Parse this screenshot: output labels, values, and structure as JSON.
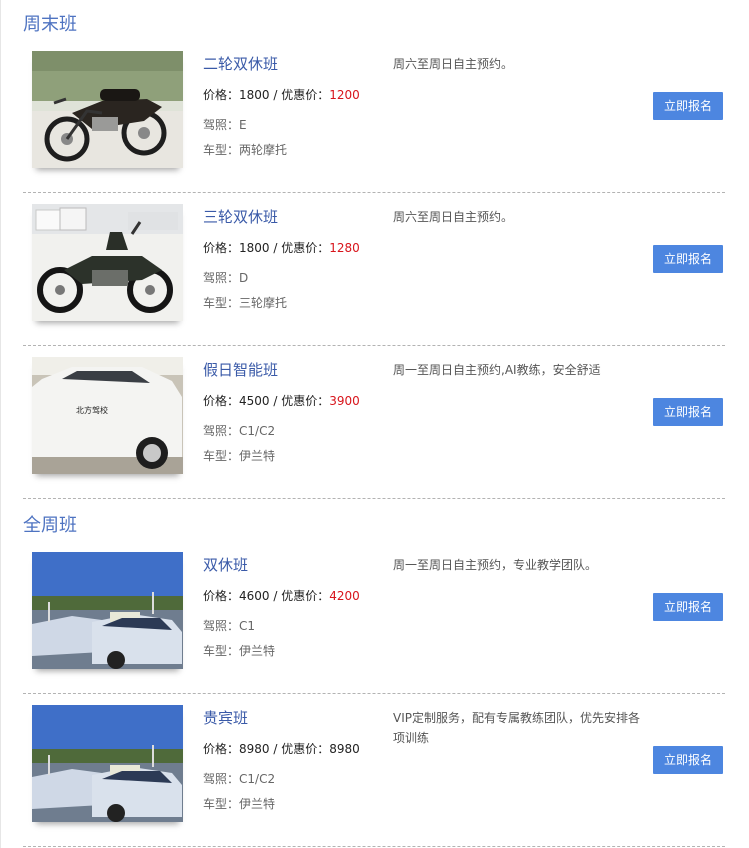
{
  "sections": [
    {
      "title": "周末班",
      "courses": [
        {
          "name": "二轮双休班",
          "price_label": "价格：",
          "price": "1800",
          "separator": " / 优惠价：",
          "discount_price": "1200",
          "license_label": "驾照：",
          "license": "E",
          "model_label": "车型：",
          "model": "两轮摩托",
          "description": "周六至周日自主预约。",
          "button": "立即报名",
          "image": "motorcycle-photo"
        },
        {
          "name": "三轮双休班",
          "price_label": "价格：",
          "price": "1800",
          "separator": " / 优惠价：",
          "discount_price": "1280",
          "license_label": "驾照：",
          "license": "D",
          "model_label": "车型：",
          "model": "三轮摩托",
          "description": "周六至周日自主预约。",
          "button": "立即报名",
          "image": "sidecar-motorcycle-photo"
        },
        {
          "name": "假日智能班",
          "price_label": "价格：",
          "price": "4500",
          "separator": " / 优惠价：",
          "discount_price": "3900",
          "license_label": "驾照：",
          "license": "C1/C2",
          "model_label": "车型：",
          "model": "伊兰特",
          "description": "周一至周日自主预约,AI教练，安全舒适",
          "button": "立即报名",
          "image": "white-training-car-photo"
        }
      ]
    },
    {
      "title": "全周班",
      "courses": [
        {
          "name": "双休班",
          "price_label": "价格：",
          "price": "4600",
          "separator": " / 优惠价：",
          "discount_price": "4200",
          "license_label": "驾照：",
          "license": "C1",
          "model_label": "车型：",
          "model": "伊兰特",
          "description": "周一至周日自主预约，专业教学团队。",
          "button": "立即报名",
          "image": "training-cars-lot-photo"
        },
        {
          "name": "贵宾班",
          "price_label": "价格：",
          "price": "8980",
          "separator": " / 优惠价：",
          "discount_price": "8980",
          "license_label": "驾照：",
          "license": "C1/C2",
          "model_label": "车型：",
          "model": "伊兰特",
          "description": "VIP定制服务，配有专属教练团队，优先安排各项训练",
          "button": "立即报名",
          "image": "training-cars-lot-photo"
        }
      ]
    }
  ],
  "colors": {
    "section_title": "#4e73c1",
    "course_name": "#3a5aa8",
    "discount_price": "#d8141b",
    "button": "#4d86e0"
  },
  "thumbnail_caption": "北方驾校"
}
